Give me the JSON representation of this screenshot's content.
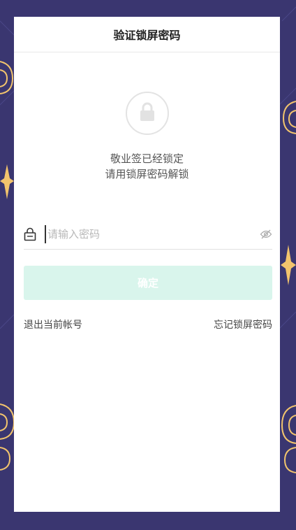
{
  "header": {
    "title": "验证锁屏密码"
  },
  "notice": {
    "line1": "敬业签已经锁定",
    "line2": "请用锁屏密码解锁"
  },
  "password": {
    "placeholder": "请输入密码",
    "value": ""
  },
  "confirm": {
    "label": "确定"
  },
  "links": {
    "logout": "退出当前帐号",
    "forgot": "忘记锁屏密码"
  },
  "colors": {
    "background": "#3a3670",
    "ornament": "#f2c46d",
    "button": "#d9f5ec"
  },
  "icons": {
    "lock_large": "lock-icon",
    "lock_small": "lock-icon",
    "eye": "eye-off-icon"
  }
}
